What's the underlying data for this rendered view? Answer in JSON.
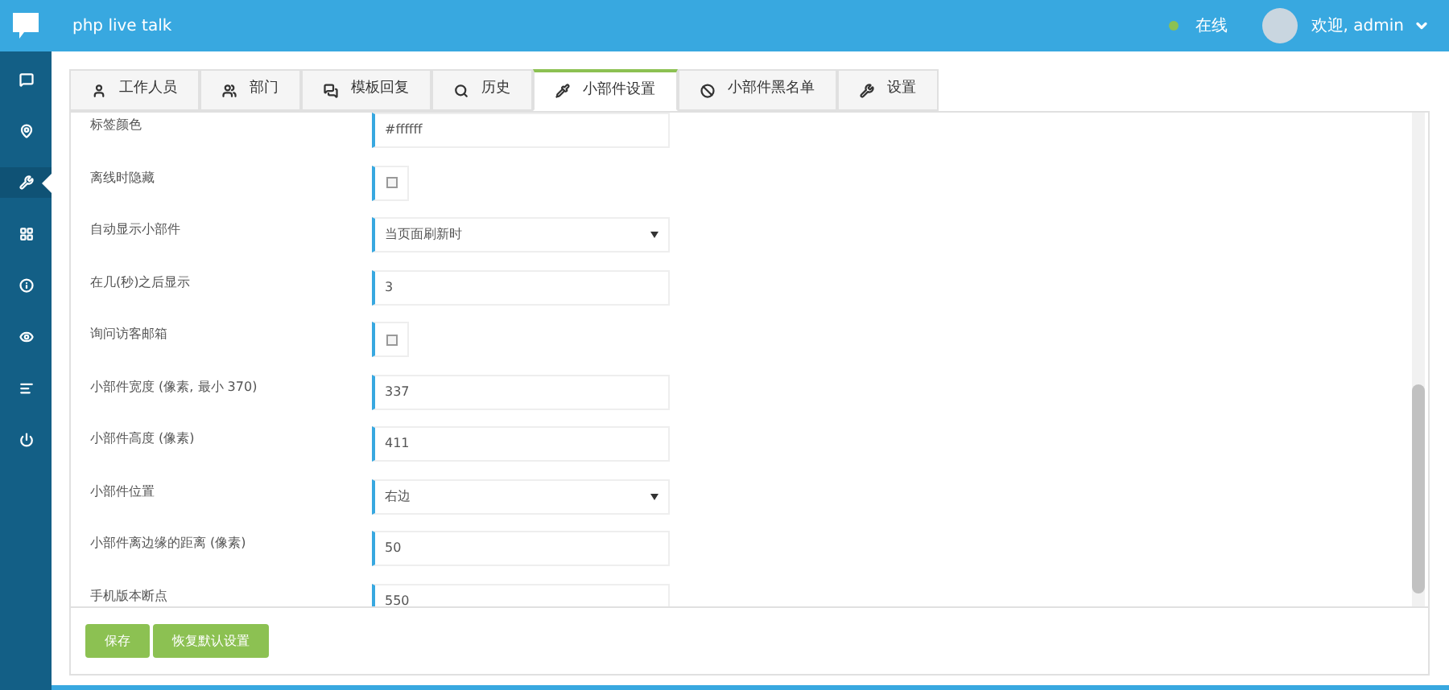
{
  "header": {
    "title": "php live talk",
    "status": {
      "label": "在线",
      "color": "#8cc152"
    },
    "user": "欢迎, admin"
  },
  "sidebar": {
    "items": [
      {
        "kind": "chat",
        "selected": false
      },
      {
        "kind": "pin",
        "selected": false
      },
      {
        "kind": "wrench",
        "selected": true
      },
      {
        "kind": "grid",
        "selected": false
      },
      {
        "kind": "info",
        "selected": false
      },
      {
        "kind": "eye",
        "selected": false
      },
      {
        "kind": "list",
        "selected": false
      },
      {
        "kind": "power",
        "selected": false
      }
    ]
  },
  "tabs": [
    {
      "label": "工作人员",
      "kind": "user",
      "selected": false
    },
    {
      "label": "部门",
      "kind": "group",
      "selected": false
    },
    {
      "label": "模板回复",
      "kind": "comments",
      "selected": false
    },
    {
      "label": "历史",
      "kind": "search",
      "selected": false
    },
    {
      "label": "小部件设置",
      "kind": "pen",
      "selected": true
    },
    {
      "label": "小部件黑名单",
      "kind": "ban",
      "selected": false
    },
    {
      "label": "设置",
      "kind": "wrench",
      "selected": false
    }
  ],
  "form": [
    {
      "kind": "text",
      "label": "标签颜色",
      "value": "#ffffff"
    },
    {
      "kind": "checkbox",
      "label": "离线时隐藏",
      "checked": false
    },
    {
      "kind": "select",
      "label": "自动显示小部件",
      "value": "当页面刷新时"
    },
    {
      "kind": "text",
      "label": "在几(秒)之后显示",
      "value": "3"
    },
    {
      "kind": "checkbox",
      "label": "询问访客邮箱",
      "checked": false
    },
    {
      "kind": "text",
      "label": "小部件宽度 (像素, 最小 370)",
      "value": "337"
    },
    {
      "kind": "text",
      "label": "小部件高度 (像素)",
      "value": "411"
    },
    {
      "kind": "select",
      "label": "小部件位置",
      "value": "右边"
    },
    {
      "kind": "text",
      "label": "小部件离边缘的距离 (像素)",
      "value": "50"
    },
    {
      "kind": "text",
      "label": "手机版本断点",
      "value": "550"
    }
  ],
  "buttons": [
    "保存",
    "恢复默认设置"
  ]
}
